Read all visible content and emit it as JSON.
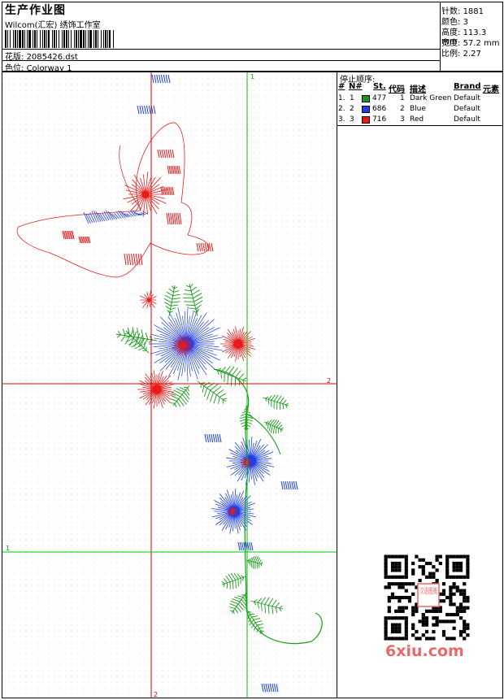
{
  "header": {
    "title": "生产作业图",
    "subtitle": "Wilcom(汇宏) 绣饰工作室",
    "design_label": "花版:",
    "design_value": "2085426.dst",
    "colorway_label": "色位:",
    "colorway_value": "Colorway 1"
  },
  "stats": [
    {
      "label": "针数:",
      "value": "1881"
    },
    {
      "label": "颜色:",
      "value": "3"
    },
    {
      "label": "高度:",
      "value": "113.3 mm"
    },
    {
      "label": "宽度:",
      "value": "57.2 mm"
    },
    {
      "label": "比例:",
      "value": "2.27"
    }
  ],
  "stop_sequence": {
    "title": "停止顺序:",
    "columns": [
      "#",
      "N#",
      "St.",
      "代码",
      "描述",
      "Brand",
      "元素"
    ],
    "rows": [
      {
        "num": "1.",
        "n": "1",
        "swatch": "#1a9a1a",
        "st": "477",
        "code": "1",
        "desc": "Dark Green",
        "brand": "Default"
      },
      {
        "num": "2.",
        "n": "2",
        "swatch": "#1b3fe8",
        "st": "686",
        "code": "2",
        "desc": "Blue",
        "brand": "Default"
      },
      {
        "num": "3.",
        "n": "3",
        "swatch": "#e81a1a",
        "st": "716",
        "code": "3",
        "desc": "Red",
        "brand": "Default"
      }
    ]
  },
  "guides": {
    "vertical_green_label": "1",
    "horizontal_red_label": "2",
    "horizontal_green_label": "1",
    "vertical_red_label": "2"
  },
  "colors": {
    "green": "#1a9a1a",
    "blue": "#1b3fe8",
    "red": "#e81a1a",
    "guide_green": "#00cc00",
    "guide_red": "#dd0000"
  },
  "watermark": "6xiu.com",
  "qr_badge": "汉语图腾",
  "qr_icon": "qr-code-icon"
}
